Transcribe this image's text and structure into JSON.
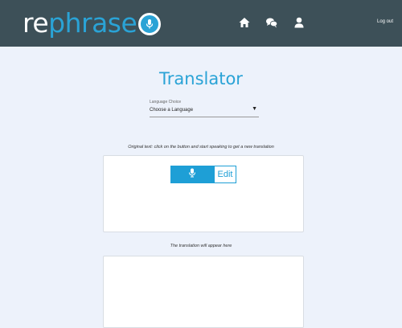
{
  "header": {
    "logo": {
      "part1": "re",
      "part2": "phrase"
    },
    "nav": {
      "home_icon": "home-icon",
      "chat_icon": "chat-icon",
      "user_icon": "user-icon",
      "logout_label": "Log out"
    }
  },
  "main": {
    "title": "Translator",
    "language": {
      "label": "Language Choice",
      "selected": "Choose a Language",
      "caret": "▼"
    },
    "original_caption": "Original text: click on the button and start speaking to get a new translation",
    "mic_button_icon": "microphone-icon",
    "edit_label": "Edit",
    "translation_caption": "The translation will appear here"
  },
  "colors": {
    "header_bg": "#3d5058",
    "accent": "#2aa3d6",
    "page_bg": "#edf2fb"
  }
}
